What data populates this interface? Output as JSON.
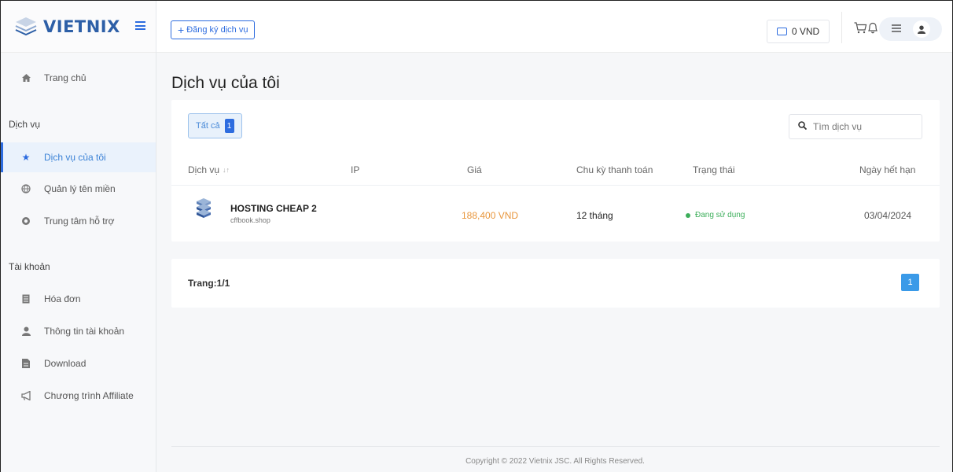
{
  "brand": {
    "name": "VIETNIX"
  },
  "header": {
    "register_label": "Đăng ký dịch vụ",
    "balance": "0 VND"
  },
  "sidebar": {
    "home": "Trang chủ",
    "section_services": "Dịch vụ",
    "services": [
      {
        "label": "Dịch vụ của tôi",
        "icon": "star-icon"
      },
      {
        "label": "Quản lý tên miền",
        "icon": "globe-icon"
      },
      {
        "label": "Trung tâm hỗ trợ",
        "icon": "lifebuoy-icon"
      }
    ],
    "section_account": "Tài khoản",
    "account": [
      {
        "label": "Hóa đơn",
        "icon": "invoice-icon"
      },
      {
        "label": "Thông tin tài khoản",
        "icon": "user-icon"
      },
      {
        "label": "Download",
        "icon": "file-icon"
      },
      {
        "label": "Chương trình Affiliate",
        "icon": "megaphone-icon"
      }
    ]
  },
  "main": {
    "title": "Dịch vụ của tôi",
    "filter_all": "Tất cả",
    "filter_count": "1",
    "search_placeholder": "Tìm dịch vụ",
    "columns": {
      "service": "Dịch vụ",
      "ip": "IP",
      "price": "Giá",
      "cycle": "Chu kỳ thanh toán",
      "status": "Trạng thái",
      "expiry": "Ngày hết hạn"
    },
    "rows": [
      {
        "name": "HOSTING CHEAP 2",
        "domain": "cffbook.shop",
        "ip": "",
        "price": "188,400 VND",
        "cycle": "12 tháng",
        "status": "Đang sử dụng",
        "expiry": "03/04/2024"
      }
    ],
    "pagination": {
      "label": "Trang:1/1",
      "current": "1"
    }
  },
  "footer": {
    "copyright": "Copyright © 2022 Vietnix JSC. All Rights Reserved."
  },
  "colors": {
    "accent": "#2d6cdf",
    "price": "#e8963c",
    "status_active": "#3cae5a"
  }
}
